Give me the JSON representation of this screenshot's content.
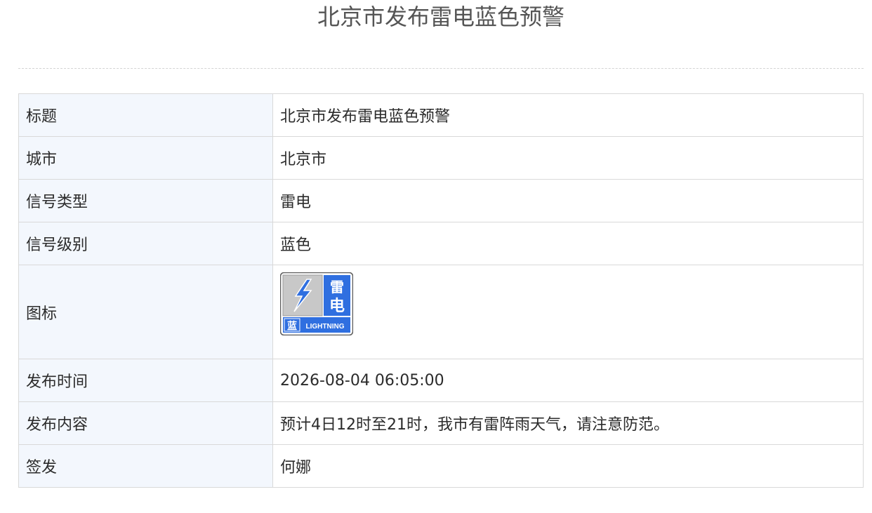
{
  "page": {
    "title": "北京市发布雷电蓝色预警"
  },
  "table": {
    "rows": [
      {
        "key": "标题",
        "value": "北京市发布雷电蓝色预警"
      },
      {
        "key": "城市",
        "value": "北京市"
      },
      {
        "key": "信号类型",
        "value": "雷电"
      },
      {
        "key": "信号级别",
        "value": "蓝色"
      },
      {
        "key": "图标",
        "value": ""
      },
      {
        "key": "发布时间",
        "value": "2026-08-04 06:05:00"
      },
      {
        "key": "发布内容",
        "value": "预计4日12时至21时，我市有雷阵雨天气，请注意防范。"
      },
      {
        "key": "签发",
        "value": "何娜"
      }
    ]
  },
  "signal_icon": {
    "name": "lightning-blue-warning-icon",
    "type_char_top": "雷",
    "type_char_bottom": "电",
    "level_char": "蓝",
    "english_label": "LIGHTNING",
    "colors": {
      "blue": "#2f6fe0",
      "panel_gray": "#c8c8c8",
      "frame": "#5a5a5a"
    }
  }
}
